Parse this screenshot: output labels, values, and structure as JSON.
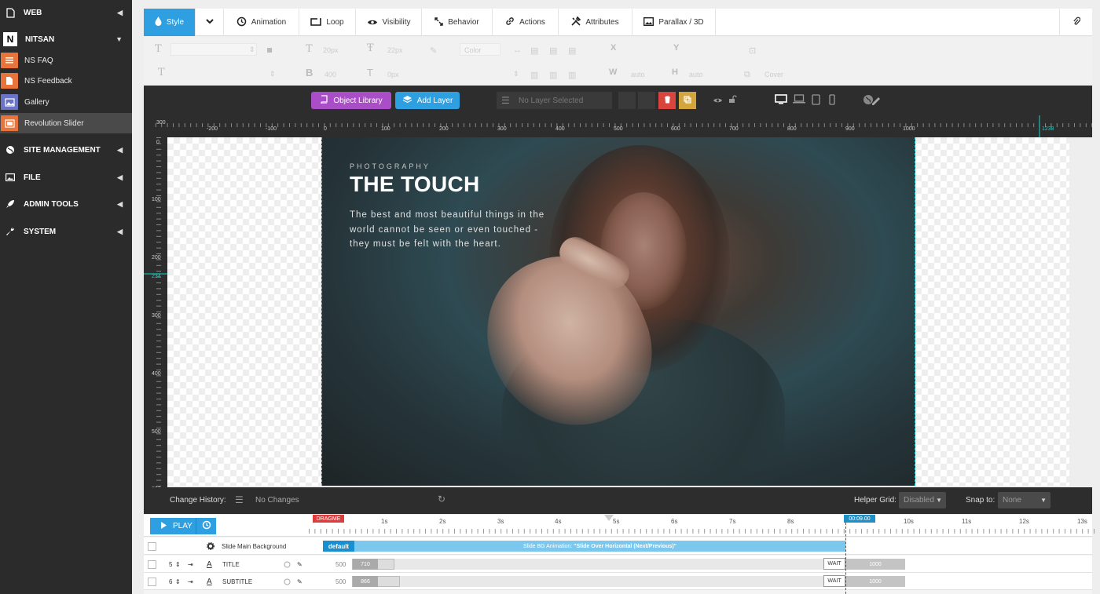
{
  "sidebar": {
    "items": [
      {
        "label": "WEB",
        "icon": "file-icon"
      },
      {
        "label": "NITSAN",
        "icon": "nitsan-logo-icon"
      },
      {
        "label": "SITE MANAGEMENT",
        "icon": "globe-icon"
      },
      {
        "label": "FILE",
        "icon": "image-icon"
      },
      {
        "label": "ADMIN TOOLS",
        "icon": "rocket-icon"
      },
      {
        "label": "SYSTEM",
        "icon": "wrench-icon"
      }
    ],
    "subitems": [
      {
        "label": "NS FAQ",
        "color": "#e8743b"
      },
      {
        "label": "NS Feedback",
        "color": "#e8743b"
      },
      {
        "label": "Gallery",
        "color": "#6b73c7"
      },
      {
        "label": "Revolution Slider",
        "color": "#e8743b"
      }
    ]
  },
  "toolbar": {
    "tabs": [
      {
        "label": "Style",
        "icon": "droplet-icon"
      },
      {
        "label": "",
        "icon": "chevron-down-icon"
      },
      {
        "label": "Animation",
        "icon": "history-icon"
      },
      {
        "label": "Loop",
        "icon": "loop-icon"
      },
      {
        "label": "Visibility",
        "icon": "eye-icon"
      },
      {
        "label": "Behavior",
        "icon": "resize-icon"
      },
      {
        "label": "Actions",
        "icon": "link-icon"
      },
      {
        "label": "Attributes",
        "icon": "tools-icon"
      },
      {
        "label": "Parallax / 3D",
        "icon": "picture-icon"
      }
    ],
    "accent": "#2e9fe0"
  },
  "props": {
    "font_size": "20px",
    "line_height": "22px",
    "color": "Color",
    "weight": "400",
    "spacing": "0px",
    "x": "X",
    "y": "Y",
    "w": "W",
    "h": "H",
    "width_val": "auto",
    "height_val": "auto",
    "cover": "Cover"
  },
  "editbar": {
    "object_library": "Object Library",
    "add_layer": "Add Layer",
    "layer_select": "No Layer Selected"
  },
  "rulers": {
    "h": [
      "-200",
      "-100",
      "0",
      "100",
      "200",
      "300",
      "400",
      "500",
      "600",
      "700",
      "800",
      "900",
      "1000",
      "1238"
    ],
    "v": [
      "0",
      "100",
      "200",
      "234",
      "300",
      "400",
      "500",
      "600"
    ]
  },
  "slide": {
    "kicker": "PHOTOGRAPHY",
    "title": "THE TOUCH",
    "text": "The best and most beautiful things in the world cannot be seen or even touched - they must be felt with the heart."
  },
  "history": {
    "label": "Change History:",
    "value": "No Changes",
    "helper_label": "Helper Grid:",
    "helper_value": "Disabled",
    "snap_label": "Snap to:",
    "snap_value": "None"
  },
  "timeline": {
    "play": "PLAY",
    "dragme": "DRAGME",
    "timecode": "00:09.00",
    "ticks": [
      "1s",
      "2s",
      "3s",
      "4s",
      "5s",
      "6s",
      "7s",
      "8s",
      "10s",
      "11s",
      "12s",
      "13s"
    ],
    "bg_row": {
      "label": "Slide Main Background",
      "badge": "default",
      "anim_prefix": "Slide BG Animation: ",
      "anim_name": "\"Slide Over Horizontal (Next/Previous)\""
    },
    "layers": [
      {
        "num": "5",
        "name": "TITLE",
        "start": "500",
        "speed": "710",
        "wait": "WAIT",
        "dur": "1000"
      },
      {
        "num": "6",
        "name": "SUBTITLE",
        "start": "500",
        "speed": "866",
        "wait": "WAIT",
        "dur": "1000"
      }
    ]
  }
}
